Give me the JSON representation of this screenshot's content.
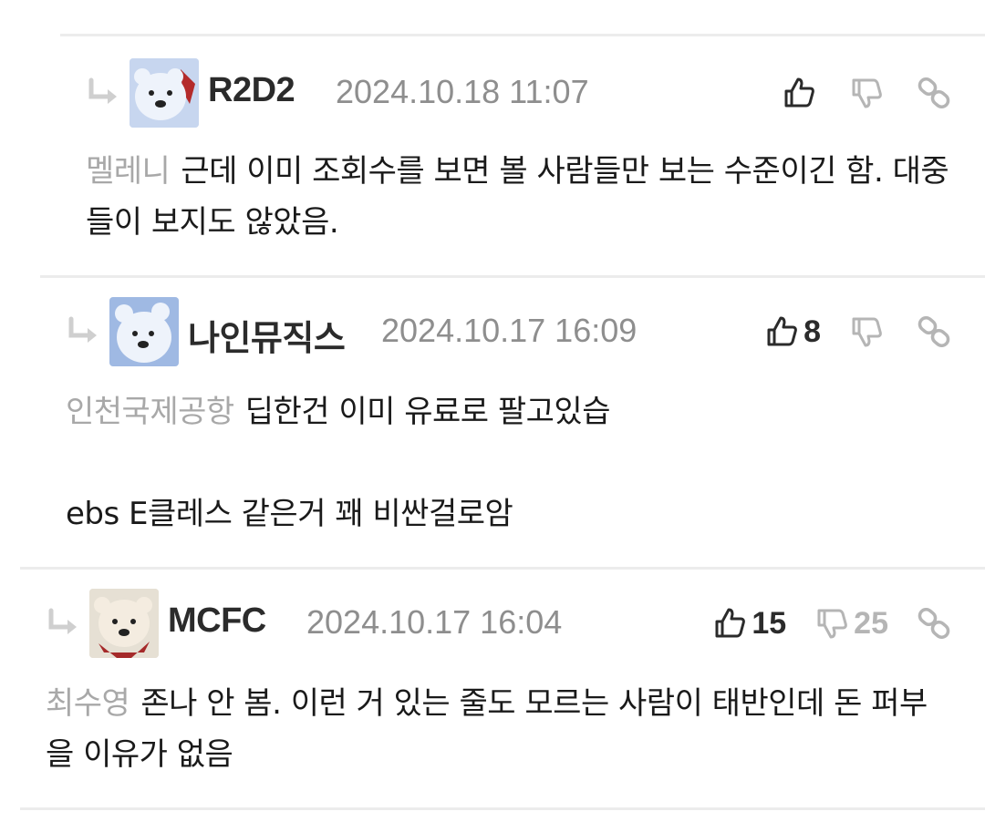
{
  "comments": [
    {
      "nickname": "R2D2",
      "date": "2024.10.18 11:07",
      "likes": "",
      "dislikes": "",
      "mention": "멜레니",
      "paragraphs": [
        "근데 이미 조회수를 보면 볼 사람들만 보는 수준이긴 함. 대중들이 보지도 않았음."
      ]
    },
    {
      "nickname": "나인뮤직스",
      "date": "2024.10.17 16:09",
      "likes": "8",
      "dislikes": "",
      "mention": "인천국제공항",
      "paragraphs": [
        "딥한건 이미 유료로 팔고있습",
        "ebs E클레스 같은거 꽤 비싼걸로암"
      ]
    },
    {
      "nickname": "MCFC",
      "date": "2024.10.17 16:04",
      "likes": "15",
      "dislikes": "25",
      "mention": "최수영",
      "paragraphs": [
        "존나 안 봄. 이런 거 있는 줄도 모르는 사람이 태반인데 돈 퍼부을 이유가 없음"
      ]
    }
  ],
  "icons": {
    "reply": "reply-arrow-icon",
    "like": "thumbs-up-icon",
    "dislike": "thumbs-down-icon",
    "link": "link-icon",
    "avatar": "polar-bear-avatar"
  },
  "colors": {
    "mention": "#a8a8a8",
    "date": "#8e8e8e",
    "divider": "#ececec",
    "count_active": "#2b2b2b",
    "count_muted": "#b5b5b5"
  }
}
